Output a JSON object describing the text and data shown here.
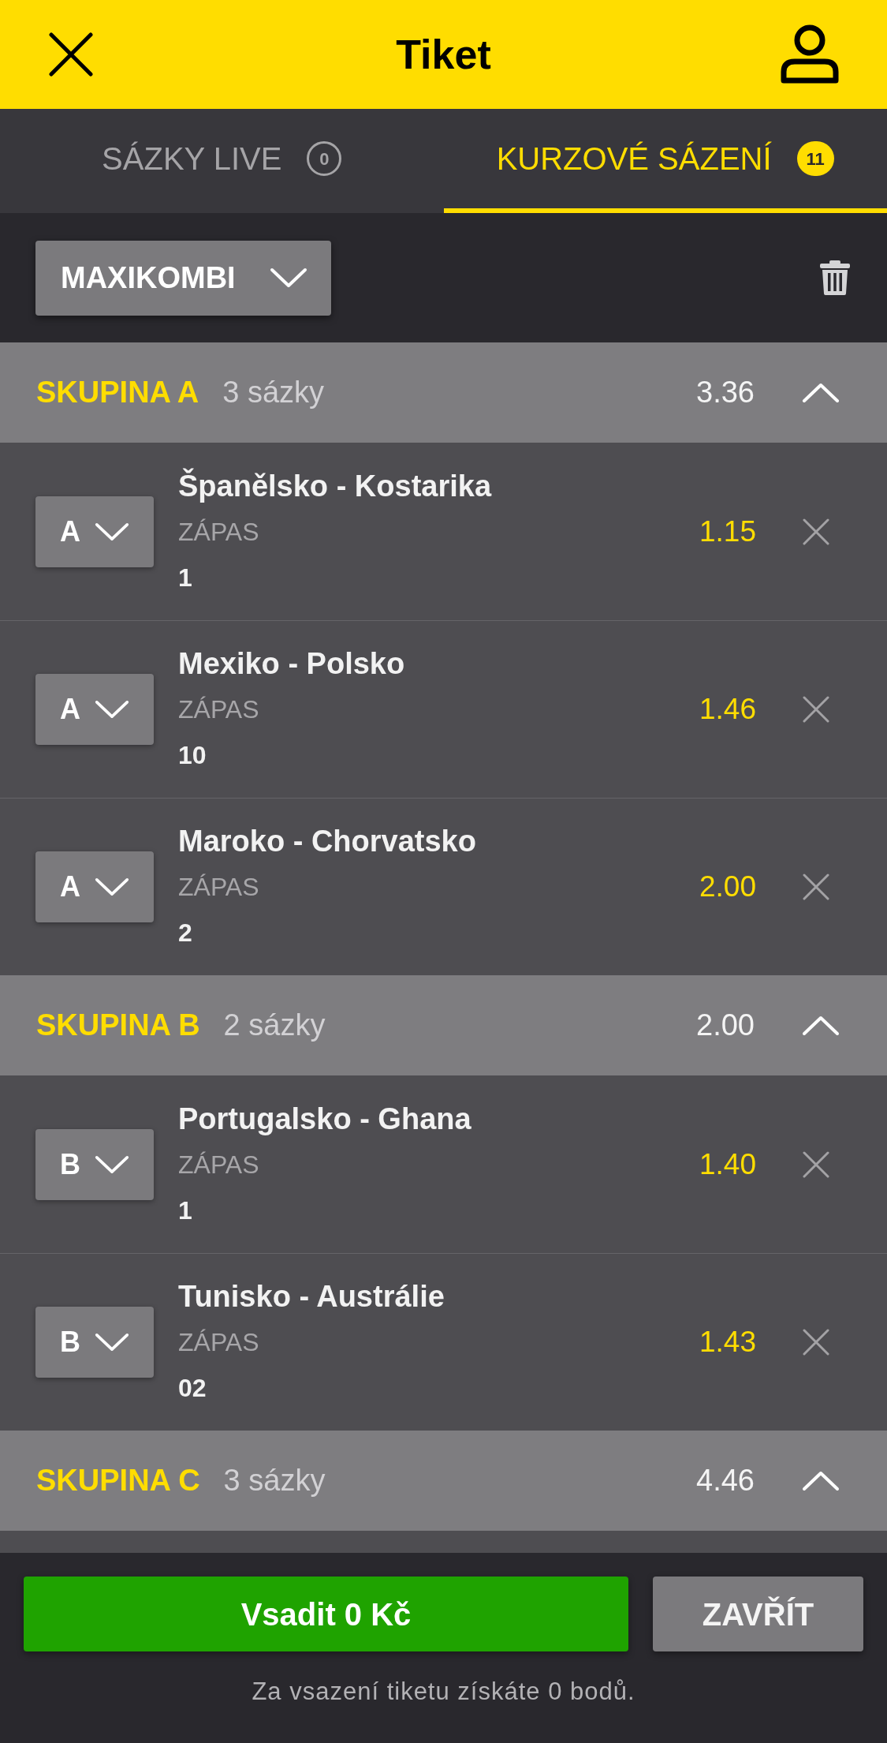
{
  "header": {
    "title": "Tiket"
  },
  "tabs": [
    {
      "label": "SÁZKY LIVE",
      "count": "0",
      "selected": false
    },
    {
      "label": "KURZOVÉ SÁZENÍ",
      "count": "11",
      "selected": true
    }
  ],
  "bet_type": {
    "label": "MAXIKOMBI"
  },
  "groups": [
    {
      "name": "SKUPINA A",
      "bet_count": "3 sázky",
      "odds": "3.36",
      "expanded": true,
      "bets": [
        {
          "group": "A",
          "match": "Španělsko - Kostarika",
          "market": "ZÁPAS",
          "pick": "1",
          "odds": "1.15"
        },
        {
          "group": "A",
          "match": "Mexiko - Polsko",
          "market": "ZÁPAS",
          "pick": "10",
          "odds": "1.46"
        },
        {
          "group": "A",
          "match": "Maroko - Chorvatsko",
          "market": "ZÁPAS",
          "pick": "2",
          "odds": "2.00"
        }
      ]
    },
    {
      "name": "SKUPINA B",
      "bet_count": "2 sázky",
      "odds": "2.00",
      "expanded": true,
      "bets": [
        {
          "group": "B",
          "match": "Portugalsko - Ghana",
          "market": "ZÁPAS",
          "pick": "1",
          "odds": "1.40"
        },
        {
          "group": "B",
          "match": "Tunisko - Austrálie",
          "market": "ZÁPAS",
          "pick": "02",
          "odds": "1.43"
        }
      ]
    },
    {
      "name": "SKUPINA C",
      "bet_count": "3 sázky",
      "odds": "4.46",
      "expanded": true
    }
  ],
  "footer": {
    "place_bet": "Vsadit 0 Kč",
    "close": "ZAVŘÍT",
    "note": "Za vsazení tiketu získáte 0 bodů."
  }
}
